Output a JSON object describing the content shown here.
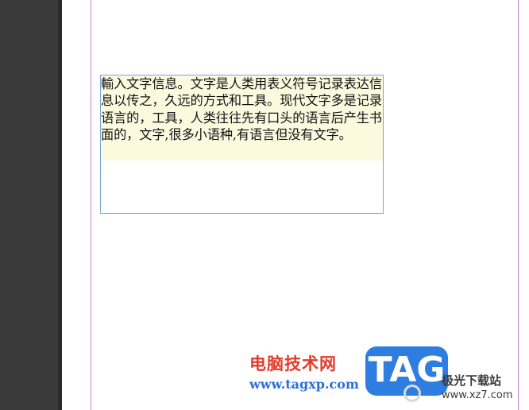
{
  "text_frame": {
    "content": "輸入文字信息。文字是人类用表义符号记录表达信息以传之，久远的方式和工具。现代文字多是记录语言的，工具，人类往往先有口头的语言后产生书面的，文字,很多小语种,有语言但没有文字。"
  },
  "watermark": {
    "site_name": "电脑技术网",
    "site_url": "www.tagxp.com",
    "logo_text": "TAG",
    "partner_name": "极光下载站",
    "partner_url": "www.xz7.com"
  },
  "colors": {
    "left_panel": "#3a3a3a",
    "page_border": "#c77fbf",
    "frame_border": "#7aa6d4",
    "text_highlight": "#fbfadf",
    "logo_bg": "#2d7ee0",
    "site_name_color": "#e23b2b",
    "site_url_color": "#2f6fd6"
  }
}
